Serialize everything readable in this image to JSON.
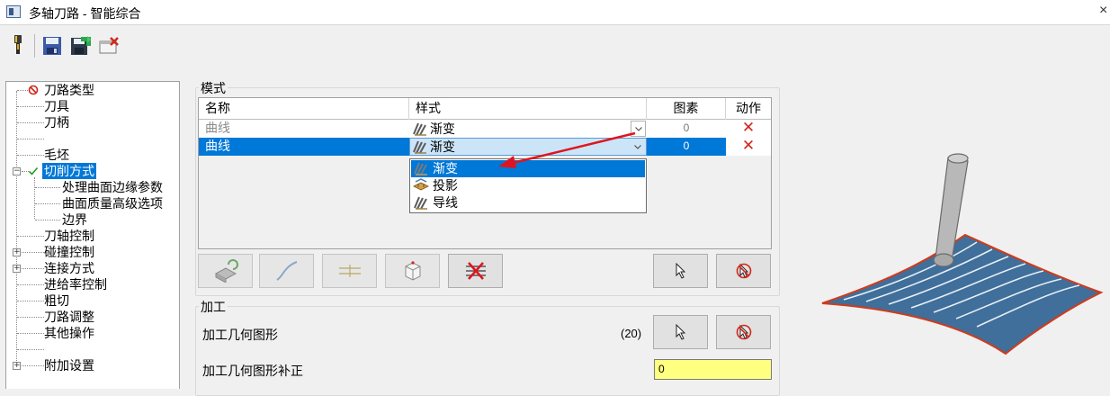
{
  "window": {
    "title": "多轴刀路 - 智能综合",
    "close_symbol": "×"
  },
  "toolbar": {
    "icons": [
      "tool-lamp-icon",
      "save-icon",
      "save-new-icon",
      "cancel-icon"
    ]
  },
  "tree": {
    "items": [
      {
        "label": "刀路类型",
        "icon": "forbidden-icon",
        "status_color": "#d0281c"
      },
      {
        "label": "刀具"
      },
      {
        "label": "刀柄"
      },
      {
        "label": "毛坯"
      },
      {
        "label": "切削方式",
        "icon": "check-icon",
        "status_color": "#1aa31a",
        "expand": "−"
      },
      {
        "label": "处理曲面边缘参数"
      },
      {
        "label": "曲面质量高级选项"
      },
      {
        "label": "边界"
      },
      {
        "label": "刀轴控制"
      },
      {
        "label": "碰撞控制",
        "expand": "+"
      },
      {
        "label": "连接方式",
        "expand": "+"
      },
      {
        "label": "进给率控制"
      },
      {
        "label": "粗切"
      },
      {
        "label": "刀路调整"
      },
      {
        "label": "其他操作"
      },
      {
        "label": "附加设置",
        "expand": "+"
      }
    ]
  },
  "pattern_group": {
    "title": "模式",
    "columns": [
      "名称",
      "样式",
      "图素",
      "动作"
    ],
    "rows": [
      {
        "name": "曲线",
        "style": "渐变",
        "count": "0",
        "action": "✕"
      },
      {
        "name": "曲线",
        "style": "渐变",
        "count": "0",
        "action": "✕"
      }
    ],
    "dropdown_options": [
      "渐变",
      "投影",
      "导线"
    ],
    "selected_option": "渐变"
  },
  "process_group": {
    "title": "加工",
    "geometry_label": "加工几何图形",
    "geometry_count": "(20)",
    "offset_label": "加工几何图形补正",
    "offset_value": "0"
  },
  "colors": {
    "accent": "#0078d7",
    "delete_red": "#d0281c",
    "input_yellow": "#ffff80",
    "arrow_red": "#e0141e",
    "surface_blue": "#3f6f9a"
  }
}
